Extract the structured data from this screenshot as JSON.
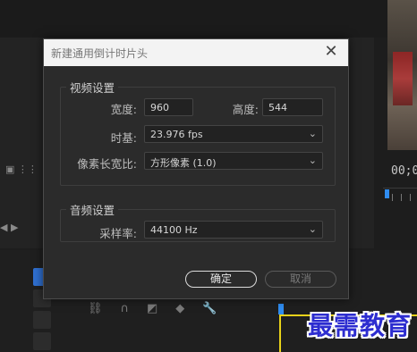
{
  "background": {
    "timecode": "00;0",
    "watermark": "最需教育"
  },
  "dialog": {
    "title": "新建通用倒计时片头",
    "close_glyph": "✕",
    "video_section": {
      "legend": "视频设置",
      "width_label": "宽度:",
      "width_value": "960",
      "height_label": "高度:",
      "height_value": "544",
      "timebase_label": "时基:",
      "timebase_value": "23.976 fps",
      "aspect_label": "像素长宽比:",
      "aspect_value": "方形像素 (1.0)"
    },
    "audio_section": {
      "legend": "音频设置",
      "samplerate_label": "采样率:",
      "samplerate_value": "44100 Hz"
    },
    "ok_label": "确定",
    "cancel_label": "取消"
  },
  "colors": {
    "accent_blue": "#2f8cf0",
    "timeline_yellow": "#e8d21a",
    "watermark_blue": "#2d2dd0"
  }
}
